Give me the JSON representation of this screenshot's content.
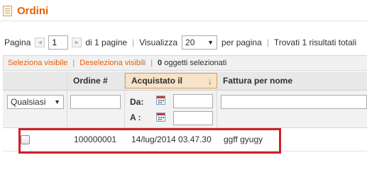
{
  "header": {
    "title": "Ordini",
    "icon": "orders-icon"
  },
  "pager": {
    "page_label": "Pagina",
    "page_value": "1",
    "of_pages": "di 1 pagine",
    "view_label": "Visualizza",
    "per_page_value": "20",
    "per_page_label": "per pagina",
    "found": "Trovati 1 risultati totali"
  },
  "massaction": {
    "select_visible": "Seleziona visibile",
    "deselect_visible": "Deseleziona visibili",
    "selected_count": "0",
    "selected_label": "oggetti selezionati"
  },
  "grid": {
    "columns": [
      {
        "label": ""
      },
      {
        "label": "Ordine #"
      },
      {
        "label": "Acquistato il",
        "sorted": true,
        "sort_dir": "↓"
      },
      {
        "label": "Fattura per nome"
      }
    ],
    "filters": {
      "massaction_select": "Qualsiasi",
      "date_from_label": "Da:",
      "date_to_label": "A :"
    },
    "rows": [
      {
        "order": "100000001",
        "purchased": "14/lug/2014 03.47.30",
        "bill_name": "ggff gyugy"
      }
    ]
  },
  "colors": {
    "accent": "#eb5e00",
    "highlight": "#d0202a"
  }
}
